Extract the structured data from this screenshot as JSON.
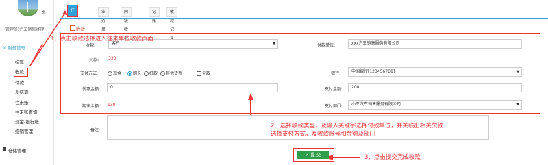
{
  "sidebar": {
    "user": "管理员(汽车销售经理)",
    "section": "财务管理",
    "items": [
      "结算",
      "收款",
      "付款",
      "反结算",
      "往来账",
      "往来账查询",
      "现金-银行账",
      "报销管理"
    ],
    "bottom": "仓储管理"
  },
  "tabs": [
    "往来单位",
    "业务单",
    "同级收款",
    "记账",
    "收款记录"
  ],
  "form": {
    "title": "收款",
    "customer_label": "客户",
    "customer_value": "客户",
    "payer_label": "付款单位:",
    "payer_value": "xxx汽车销售服务有限公司",
    "owed_label": "欠款:",
    "owed_value": "330",
    "pay_method_label": "支付方式:",
    "pay_methods": [
      "现金",
      "刷卡",
      "抵款",
      "其他货币"
    ],
    "owe_checkbox": "欠款",
    "bank_label": "银行:",
    "bank_value": "中国银行[1234567B8]",
    "discount_label": "优惠金额:",
    "discount_value": "0",
    "paid_label": "支付金额:",
    "paid_value": "200",
    "end_owed_label": "期末余额:",
    "end_owed_value": "130",
    "dept_label": "支付部门:",
    "dept_value": "小王汽车销售服务有限公司",
    "remark_label": "备注:",
    "submit_label": "提 交"
  },
  "annotations": {
    "step1": "1、点击收款选择进入往来单位收款页面",
    "step2_line1": "2、选择收款类型，及输入关键字选择付款单位，并关联出相关欠款",
    "step2_line2": "选择支付方式，及收款账号和金额及部门",
    "step3": "3、点击提交完成收款"
  },
  "colors": {
    "accent": "#2ea0d8",
    "annotation": "#ee3333",
    "submit": "#2e9e4a"
  }
}
